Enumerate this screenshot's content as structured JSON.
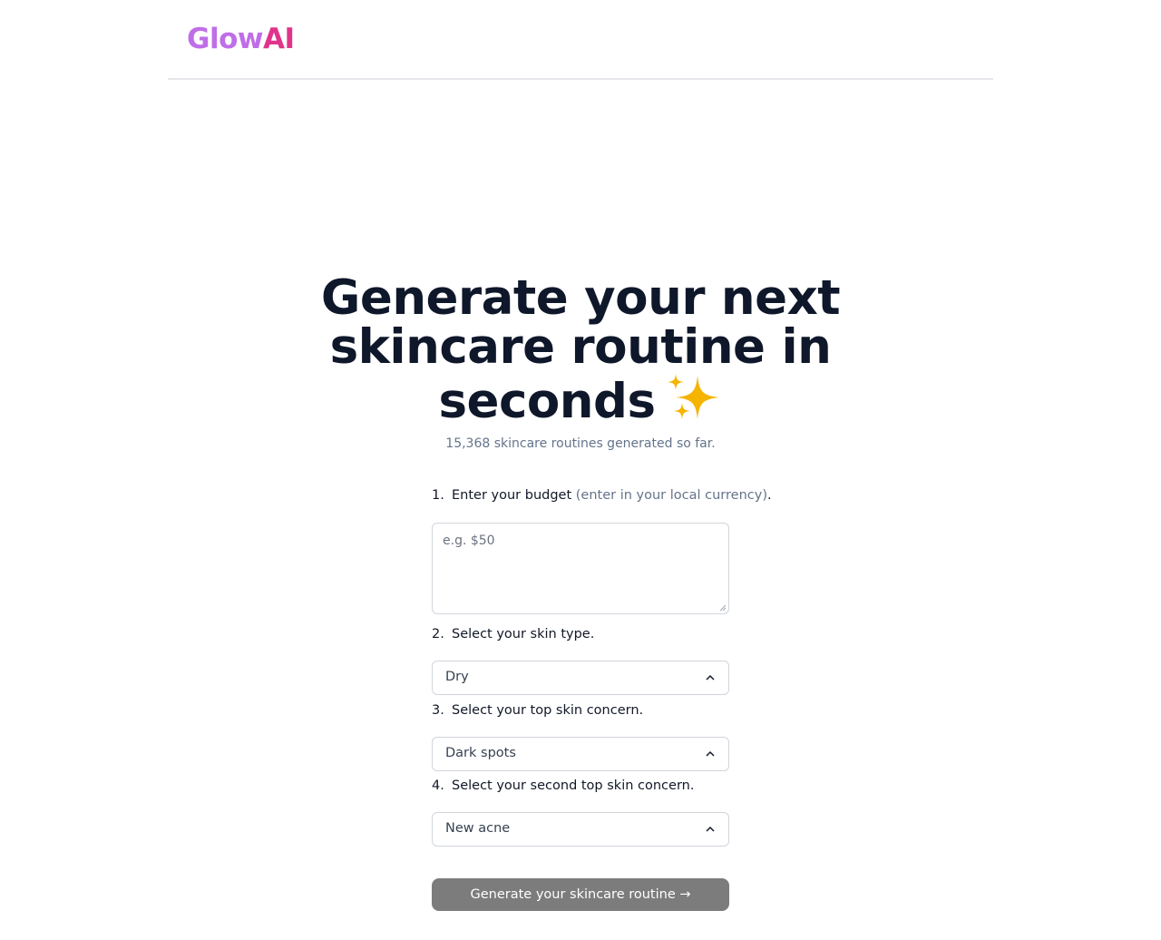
{
  "header": {
    "logo_part1": "Glow",
    "logo_part2": "AI",
    "colors": {
      "glow": "#c06ee8",
      "ai": "#e0338a"
    }
  },
  "hero": {
    "title": "Generate your next skincare routine in seconds",
    "emoji_icon": "sparkles-icon",
    "count_text": "15,368 skincare routines generated so far."
  },
  "form": {
    "step1": {
      "num": "1.",
      "label": "Enter your budget",
      "hint": "(enter in your local currency)",
      "suffix": "."
    },
    "budget_placeholder": "e.g. $50",
    "step2": {
      "num": "2.",
      "label": "Select your skin type."
    },
    "skin_type": "Dry",
    "step3": {
      "num": "3.",
      "label": "Select your top skin concern."
    },
    "top_concern": "Dark spots",
    "step4": {
      "num": "4.",
      "label": "Select your second top skin concern."
    },
    "second_concern": "New acne",
    "submit_label": "Generate your skincare routine →"
  }
}
